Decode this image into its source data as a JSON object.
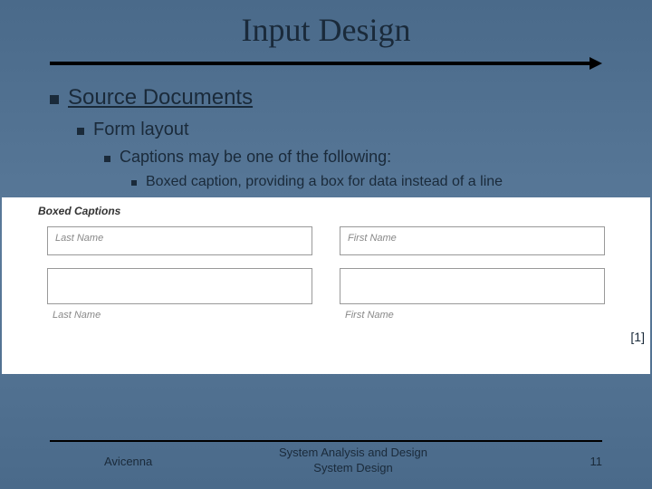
{
  "title": "Input Design",
  "outline": {
    "l1": "Source Documents",
    "l2": "Form layout",
    "l3": "Captions may be one of the following:",
    "l4": "Boxed caption, providing a box for data instead of a line"
  },
  "figure": {
    "heading": "Boxed Captions",
    "row1_left": "Last Name",
    "row1_right": "First Name",
    "row3_left": "Last Name",
    "row3_right": "First Name"
  },
  "citation": "[1]",
  "footer": {
    "left": "Avicenna",
    "center_line1": "System Analysis and Design",
    "center_line2": "System Design",
    "page": "11"
  }
}
